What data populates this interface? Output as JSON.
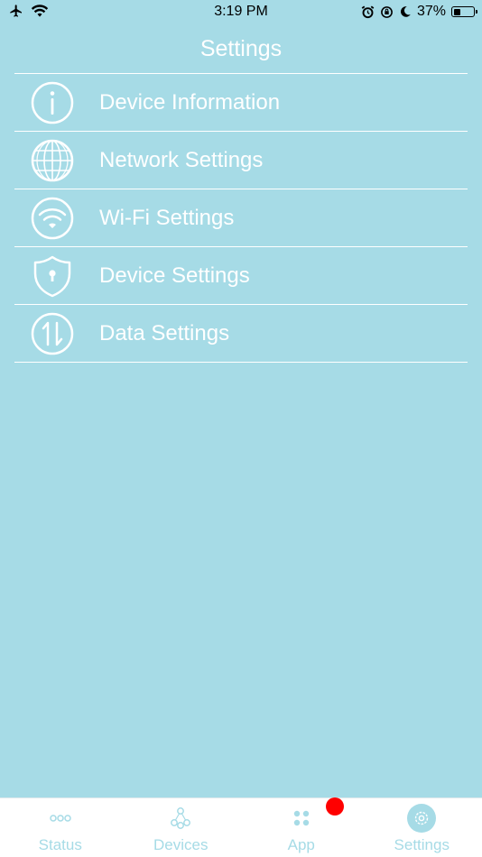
{
  "status_bar": {
    "time": "3:19 PM",
    "battery_percent": "37%",
    "battery_level": 0.37
  },
  "header": {
    "title": "Settings"
  },
  "menu": {
    "items": [
      {
        "label": "Device Information",
        "icon": "info-icon"
      },
      {
        "label": "Network Settings",
        "icon": "globe-icon"
      },
      {
        "label": "Wi-Fi Settings",
        "icon": "wifi-icon"
      },
      {
        "label": "Device Settings",
        "icon": "shield-icon"
      },
      {
        "label": "Data Settings",
        "icon": "data-transfer-icon"
      }
    ]
  },
  "tab_bar": {
    "tabs": [
      {
        "label": "Status",
        "icon": "status-icon"
      },
      {
        "label": "Devices",
        "icon": "devices-icon"
      },
      {
        "label": "App",
        "icon": "app-icon"
      },
      {
        "label": "Settings",
        "icon": "gear-icon",
        "active": true
      }
    ]
  },
  "colors": {
    "background": "#a6dbe6",
    "text": "#ffffff",
    "tab_inactive": "#a6dbe6",
    "badge": "#ff0000"
  }
}
